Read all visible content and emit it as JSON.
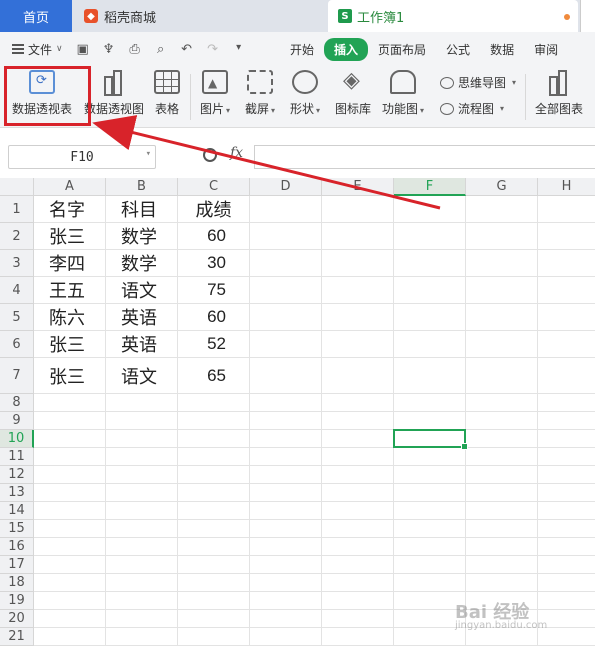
{
  "tabs": {
    "home": "首页",
    "store": "稻壳商城",
    "workbook": "工作簿1"
  },
  "menu": {
    "file": "文件",
    "items": [
      "开始",
      "插入",
      "页面布局",
      "公式",
      "数据",
      "审阅"
    ],
    "active_index": 1
  },
  "ribbon": {
    "pivot_table": "数据透视表",
    "pivot_chart": "数据透视图",
    "table": "表格",
    "picture": "图片",
    "screenshot": "截屏",
    "shape": "形状",
    "icon_library": "图标库",
    "function_chart": "功能图",
    "mind_map": "思维导图",
    "flowchart": "流程图",
    "all_charts": "全部图表"
  },
  "formula_bar": {
    "cell_ref": "F10",
    "fx": "fx",
    "content": ""
  },
  "sheet": {
    "columns": [
      "A",
      "B",
      "C",
      "D",
      "E",
      "F",
      "G",
      "H"
    ],
    "selected_column": "F",
    "selected_row": "10",
    "rows": [
      "1",
      "2",
      "3",
      "4",
      "5",
      "6",
      "7",
      "8",
      "9",
      "10",
      "11",
      "12",
      "13",
      "14",
      "15",
      "16",
      "17",
      "18",
      "19",
      "20",
      "21"
    ],
    "data": [
      [
        "名字",
        "科目",
        "成绩"
      ],
      [
        "张三",
        "数学",
        "60"
      ],
      [
        "李四",
        "数学",
        "30"
      ],
      [
        "王五",
        "语文",
        "75"
      ],
      [
        "陈六",
        "英语",
        "60"
      ],
      [
        "张三",
        "英语",
        "52"
      ],
      [
        "张三",
        "语文",
        "65"
      ]
    ]
  },
  "annotation": {
    "highlight_color": "#d8232a",
    "accent_color": "#21a355"
  },
  "watermark": {
    "text": "Bai 经验",
    "sub": "jingyan.baidu.com"
  }
}
